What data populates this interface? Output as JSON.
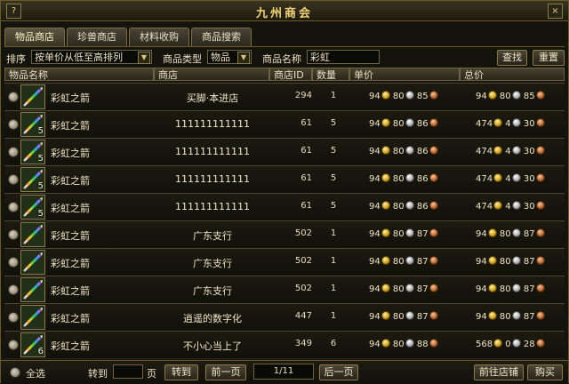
{
  "window": {
    "title": "九州商会",
    "help": "?",
    "close": "×"
  },
  "tabs": [
    {
      "label": "物品商店",
      "active": true
    },
    {
      "label": "珍兽商店",
      "active": false
    },
    {
      "label": "材料收购",
      "active": false
    },
    {
      "label": "商品搜索",
      "active": false
    }
  ],
  "filter": {
    "sort_label": "排序",
    "sort_value": "按单价从低至高排列",
    "type_label": "商品类型",
    "type_value": "物品",
    "name_label": "商品名称",
    "name_value": "彩虹",
    "search_button": "查找",
    "reset_button": "重置"
  },
  "columns": {
    "item": "物品名称",
    "shop": "商店",
    "shop_id": "商店ID",
    "qty": "数量",
    "unit_price": "单价",
    "total_price": "总价"
  },
  "rows": [
    {
      "name": "彩虹之箭",
      "shop": "买脚·本进店",
      "shop_id": "294",
      "qty": "1",
      "badge": "",
      "unit": [
        "94",
        "80",
        "85"
      ],
      "total": [
        "94",
        "80",
        "85"
      ]
    },
    {
      "name": "彩虹之箭",
      "shop": "111111111111",
      "shop_id": "61",
      "qty": "5",
      "badge": "5",
      "unit": [
        "94",
        "80",
        "86"
      ],
      "total": [
        "474",
        "4",
        "30"
      ]
    },
    {
      "name": "彩虹之箭",
      "shop": "111111111111",
      "shop_id": "61",
      "qty": "5",
      "badge": "5",
      "unit": [
        "94",
        "80",
        "86"
      ],
      "total": [
        "474",
        "4",
        "30"
      ]
    },
    {
      "name": "彩虹之箭",
      "shop": "111111111111",
      "shop_id": "61",
      "qty": "5",
      "badge": "5",
      "unit": [
        "94",
        "80",
        "86"
      ],
      "total": [
        "474",
        "4",
        "30"
      ]
    },
    {
      "name": "彩虹之箭",
      "shop": "111111111111",
      "shop_id": "61",
      "qty": "5",
      "badge": "5",
      "unit": [
        "94",
        "80",
        "86"
      ],
      "total": [
        "474",
        "4",
        "30"
      ]
    },
    {
      "name": "彩虹之箭",
      "shop": "广东支行",
      "shop_id": "502",
      "qty": "1",
      "badge": "",
      "unit": [
        "94",
        "80",
        "87"
      ],
      "total": [
        "94",
        "80",
        "87"
      ]
    },
    {
      "name": "彩虹之箭",
      "shop": "广东支行",
      "shop_id": "502",
      "qty": "1",
      "badge": "",
      "unit": [
        "94",
        "80",
        "87"
      ],
      "total": [
        "94",
        "80",
        "87"
      ]
    },
    {
      "name": "彩虹之箭",
      "shop": "广东支行",
      "shop_id": "502",
      "qty": "1",
      "badge": "",
      "unit": [
        "94",
        "80",
        "87"
      ],
      "total": [
        "94",
        "80",
        "87"
      ]
    },
    {
      "name": "彩虹之箭",
      "shop": "逍遥的数字化",
      "shop_id": "447",
      "qty": "1",
      "badge": "",
      "unit": [
        "94",
        "80",
        "87"
      ],
      "total": [
        "94",
        "80",
        "87"
      ]
    },
    {
      "name": "彩虹之箭",
      "shop": "不小心当上了",
      "shop_id": "349",
      "qty": "6",
      "badge": "6",
      "unit": [
        "94",
        "80",
        "88"
      ],
      "total": [
        "568",
        "0",
        "28"
      ]
    }
  ],
  "footer": {
    "select_all": "全选",
    "goto_label": "转到",
    "goto_value": "",
    "page_unit": "页",
    "goto_button": "转到",
    "prev_button": "前一页",
    "page_info": "1/11",
    "next_button": "后一页",
    "visit_shop_button": "前往店铺",
    "buy_button": "购买"
  },
  "colors": {
    "frame": "#6a5a2a",
    "title": "#f2d27a",
    "gold": "#c99a18",
    "silver": "#a8a8a8",
    "copper": "#b0602a"
  }
}
